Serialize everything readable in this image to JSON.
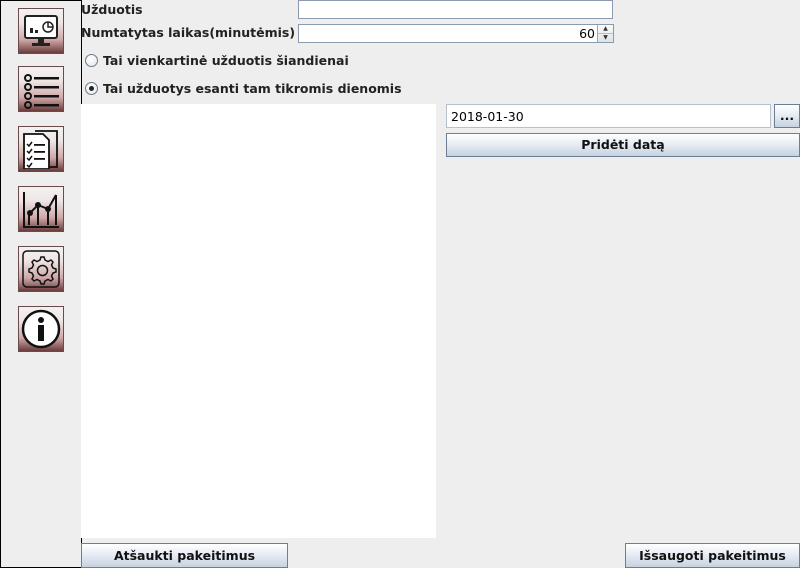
{
  "sidebar": {
    "items": [
      {
        "name": "monitor-dashboard"
      },
      {
        "name": "task-list"
      },
      {
        "name": "checklist-documents"
      },
      {
        "name": "statistics-chart"
      },
      {
        "name": "settings-gear"
      },
      {
        "name": "info"
      }
    ]
  },
  "form": {
    "task_label": "Užduotis",
    "task_value": "",
    "time_label": "Numtatytas laikas(minutėmis)",
    "time_value": "60",
    "radio_once_label": "Tai vienkartinė užduotis šiandienai",
    "radio_once_checked": false,
    "radio_days_label": "Tai užduotys esanti tam tikromis dienomis",
    "radio_days_checked": true
  },
  "date_panel": {
    "date_value": "2018-01-30",
    "picker_label": "...",
    "add_date_label": "Pridėti datą"
  },
  "footer": {
    "cancel_label": "Atšaukti pakeitimus",
    "save_label": "Išsaugoti pakeitimus"
  }
}
